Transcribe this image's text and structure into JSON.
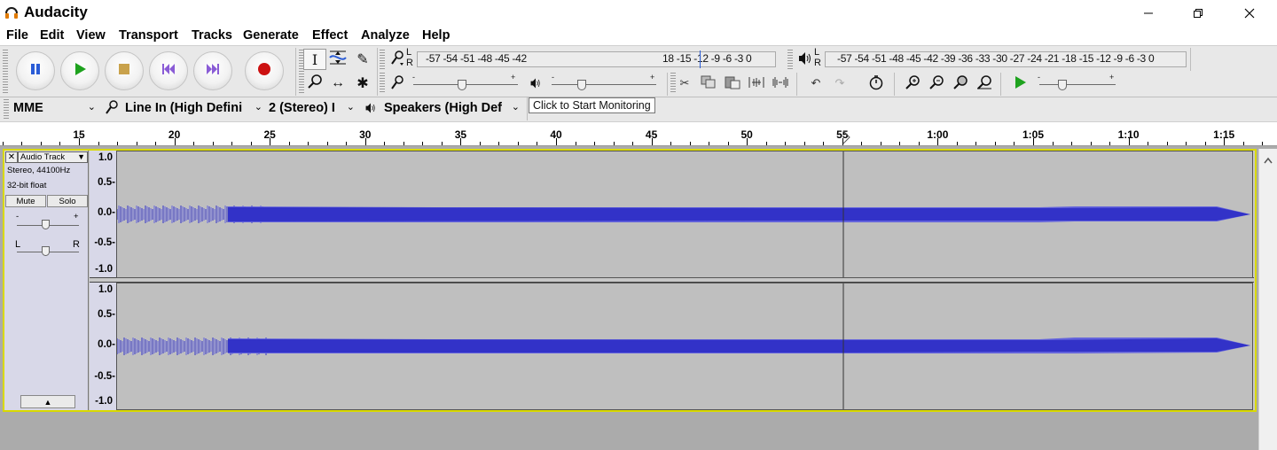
{
  "window": {
    "title": "Audacity",
    "controls": {
      "minimize": "─",
      "restore": "❐",
      "close": "✕"
    }
  },
  "menu": [
    "File",
    "Edit",
    "View",
    "Transport",
    "Tracks",
    "Generate",
    "Effect",
    "Analyze",
    "Help"
  ],
  "transport_icons": [
    "pause-icon",
    "play-icon",
    "stop-icon",
    "skip-to-start-icon",
    "skip-to-end-icon",
    "record-icon"
  ],
  "tools": {
    "selection": "I",
    "envelope": "⇿",
    "draw": "✎",
    "zoom": "🔍",
    "timeshift": "↔",
    "multi": "✱"
  },
  "record_meter": {
    "L": "L",
    "R": "R",
    "scale": "-57 -54 -51 -48 -45 -42",
    "scale_tail": "18 -15 -12  -9  -6  -3  0"
  },
  "playback_meter": {
    "L": "L",
    "R": "R",
    "scale": "-57 -54 -51 -48 -45 -42 -39 -36 -33 -30 -27 -24 -21 -18 -15 -12  -9  -6  -3  0"
  },
  "tooltip": "Click to Start Monitoring",
  "slider_marks": {
    "minus": "-",
    "plus": "+"
  },
  "device_toolbar": {
    "host": "MME",
    "recording_device": "Line In (High Defini",
    "channels": "2 (Stereo) I",
    "playback_device": "Speakers (High Def"
  },
  "ruler": {
    "labels": [
      "15",
      "20",
      "25",
      "30",
      "35",
      "40",
      "45",
      "50",
      "55",
      "1:00",
      "1:05",
      "1:10",
      "1:15"
    ]
  },
  "track": {
    "name": "Audio Track",
    "close": "✕",
    "menu_arrow": "▼",
    "format": "Stereo, 44100Hz",
    "bit_depth": "32-bit float",
    "mute": "Mute",
    "solo": "Solo",
    "gain_minus": "-",
    "gain_plus": "+",
    "pan_left": "L",
    "pan_right": "R",
    "collapse": "▲",
    "scale_labels": [
      "1.0",
      "0.5-",
      "0.0-",
      "-0.5-",
      "-1.0"
    ]
  },
  "colors": {
    "waveform": "#3232c8",
    "waveform_rms": "#6464dc",
    "track_focus": "#d9d900",
    "record_red": "#cc1111",
    "play_green": "#1ea21e"
  }
}
